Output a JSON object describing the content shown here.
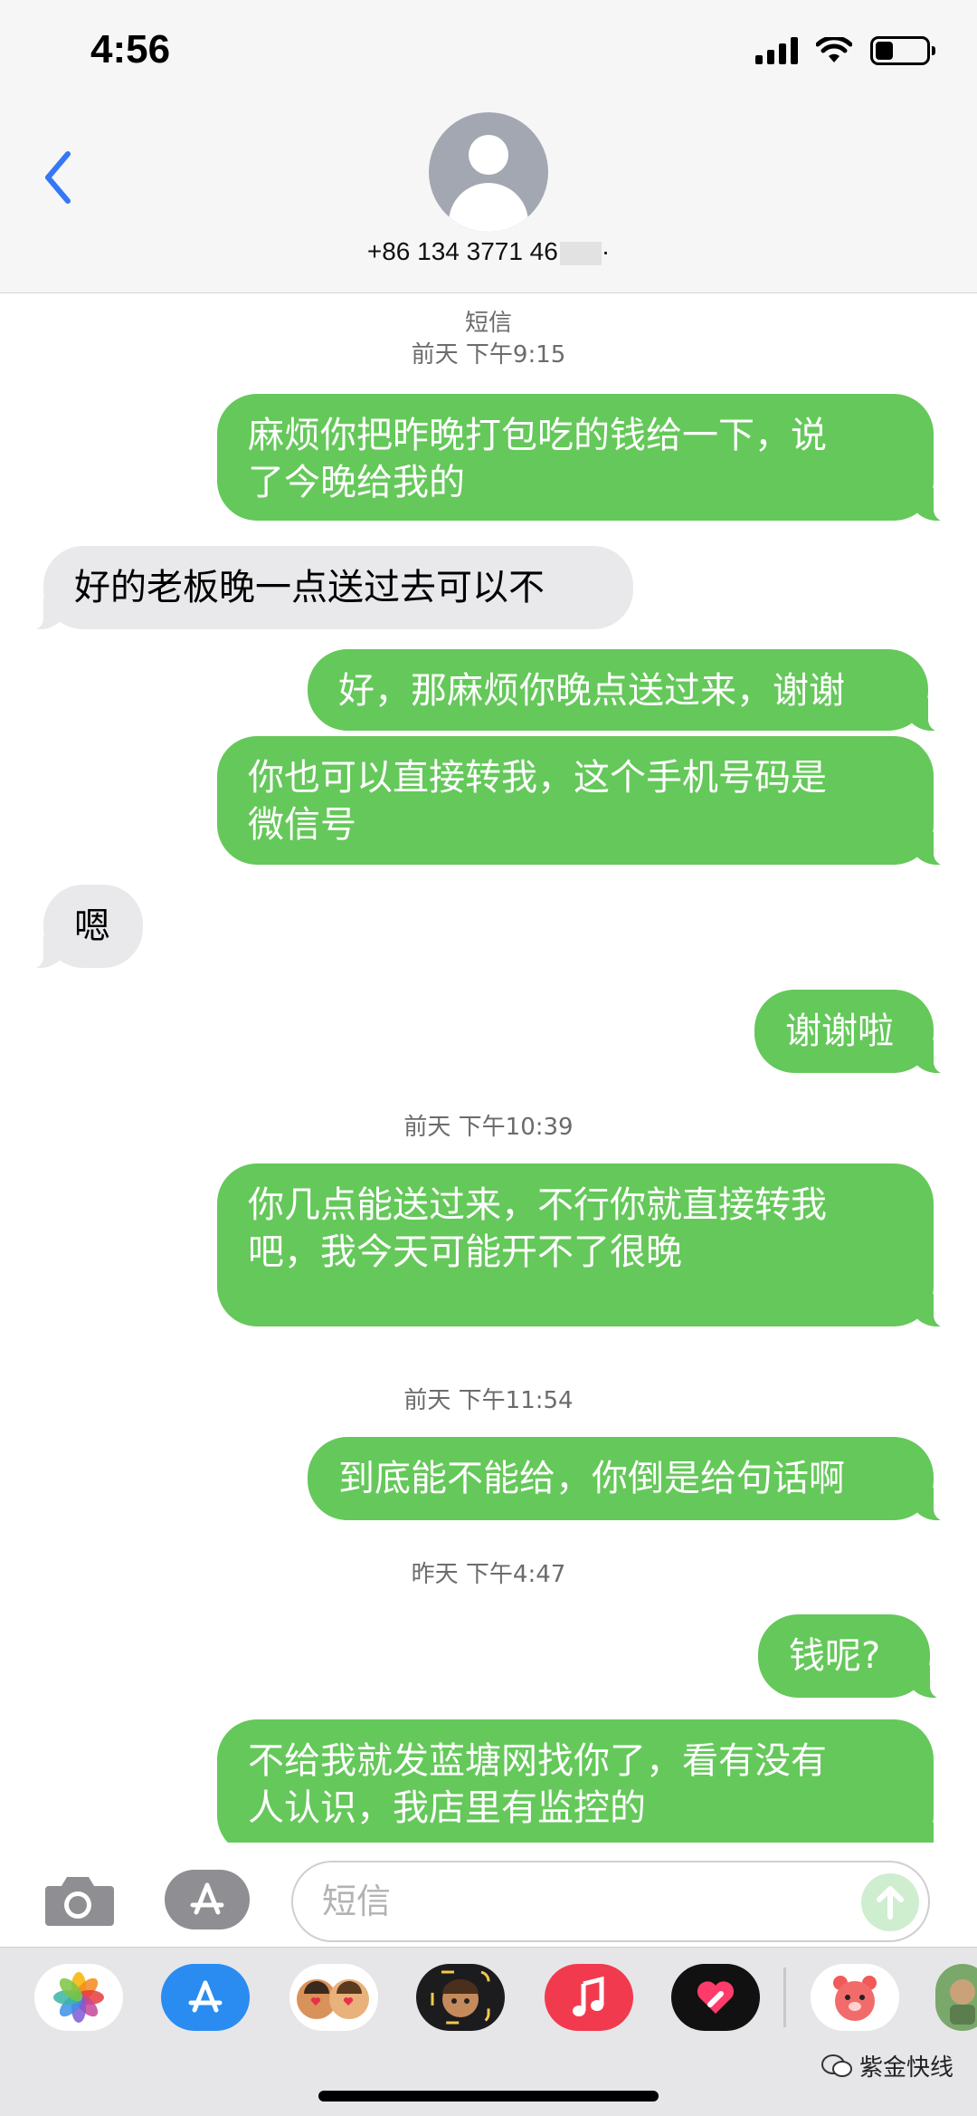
{
  "status_bar": {
    "time": "4:56",
    "battery_level": 0.35
  },
  "header": {
    "back_icon": "chevron-left-icon",
    "contact_number": "+86 134 3771 46",
    "contact_number_suffix": "·"
  },
  "messages": [
    {
      "kind": "timestamp",
      "label": "短信"
    },
    {
      "kind": "timestamp",
      "label": "前天 下午9:15"
    },
    {
      "kind": "sent",
      "lines": [
        "麻烦你把昨晚打包吃的钱给一下，说",
        "了今晚给我的"
      ]
    },
    {
      "kind": "received",
      "lines": [
        "好的老板晚一点送过去可以不"
      ]
    },
    {
      "kind": "sent",
      "lines": [
        "好，那麻烦你晚点送过来，谢谢"
      ]
    },
    {
      "kind": "sent",
      "lines": [
        "你也可以直接转我，这个手机号码是",
        "微信号"
      ]
    },
    {
      "kind": "received",
      "lines": [
        "嗯"
      ]
    },
    {
      "kind": "sent",
      "lines": [
        "谢谢啦"
      ]
    },
    {
      "kind": "timestamp",
      "label": "前天 下午10:39"
    },
    {
      "kind": "sent",
      "lines": [
        "你几点能送过来，不行你就直接转我",
        "吧，我今天可能开不了很晚"
      ]
    },
    {
      "kind": "timestamp",
      "label": "前天 下午11:54"
    },
    {
      "kind": "sent",
      "lines": [
        "到底能不能给，你倒是给句话啊"
      ]
    },
    {
      "kind": "timestamp",
      "label": "昨天 下午4:47"
    },
    {
      "kind": "sent",
      "lines": [
        "钱呢?"
      ]
    },
    {
      "kind": "sent",
      "lines": [
        "不给我就发蓝塘网找你了，看有没有",
        "人认识，我店里有监控的"
      ]
    }
  ],
  "input_bar": {
    "camera_icon": "camera-icon",
    "apps_icon": "app-store-icon",
    "placeholder": "短信",
    "send_icon": "send-arrow-icon"
  },
  "app_drawer": {
    "apps": [
      "photos-icon",
      "app-store-icon",
      "memoji-stickers-icon",
      "animoji-icon",
      "music-icon",
      "digital-touch-icon",
      "bear-sticker-icon",
      "more-app-icon"
    ]
  },
  "watermark": {
    "text": "紫金快线"
  },
  "colors": {
    "sent_bubble": "#65c85a",
    "received_bubble": "#e9e9eb",
    "accent": "#3478f6"
  }
}
